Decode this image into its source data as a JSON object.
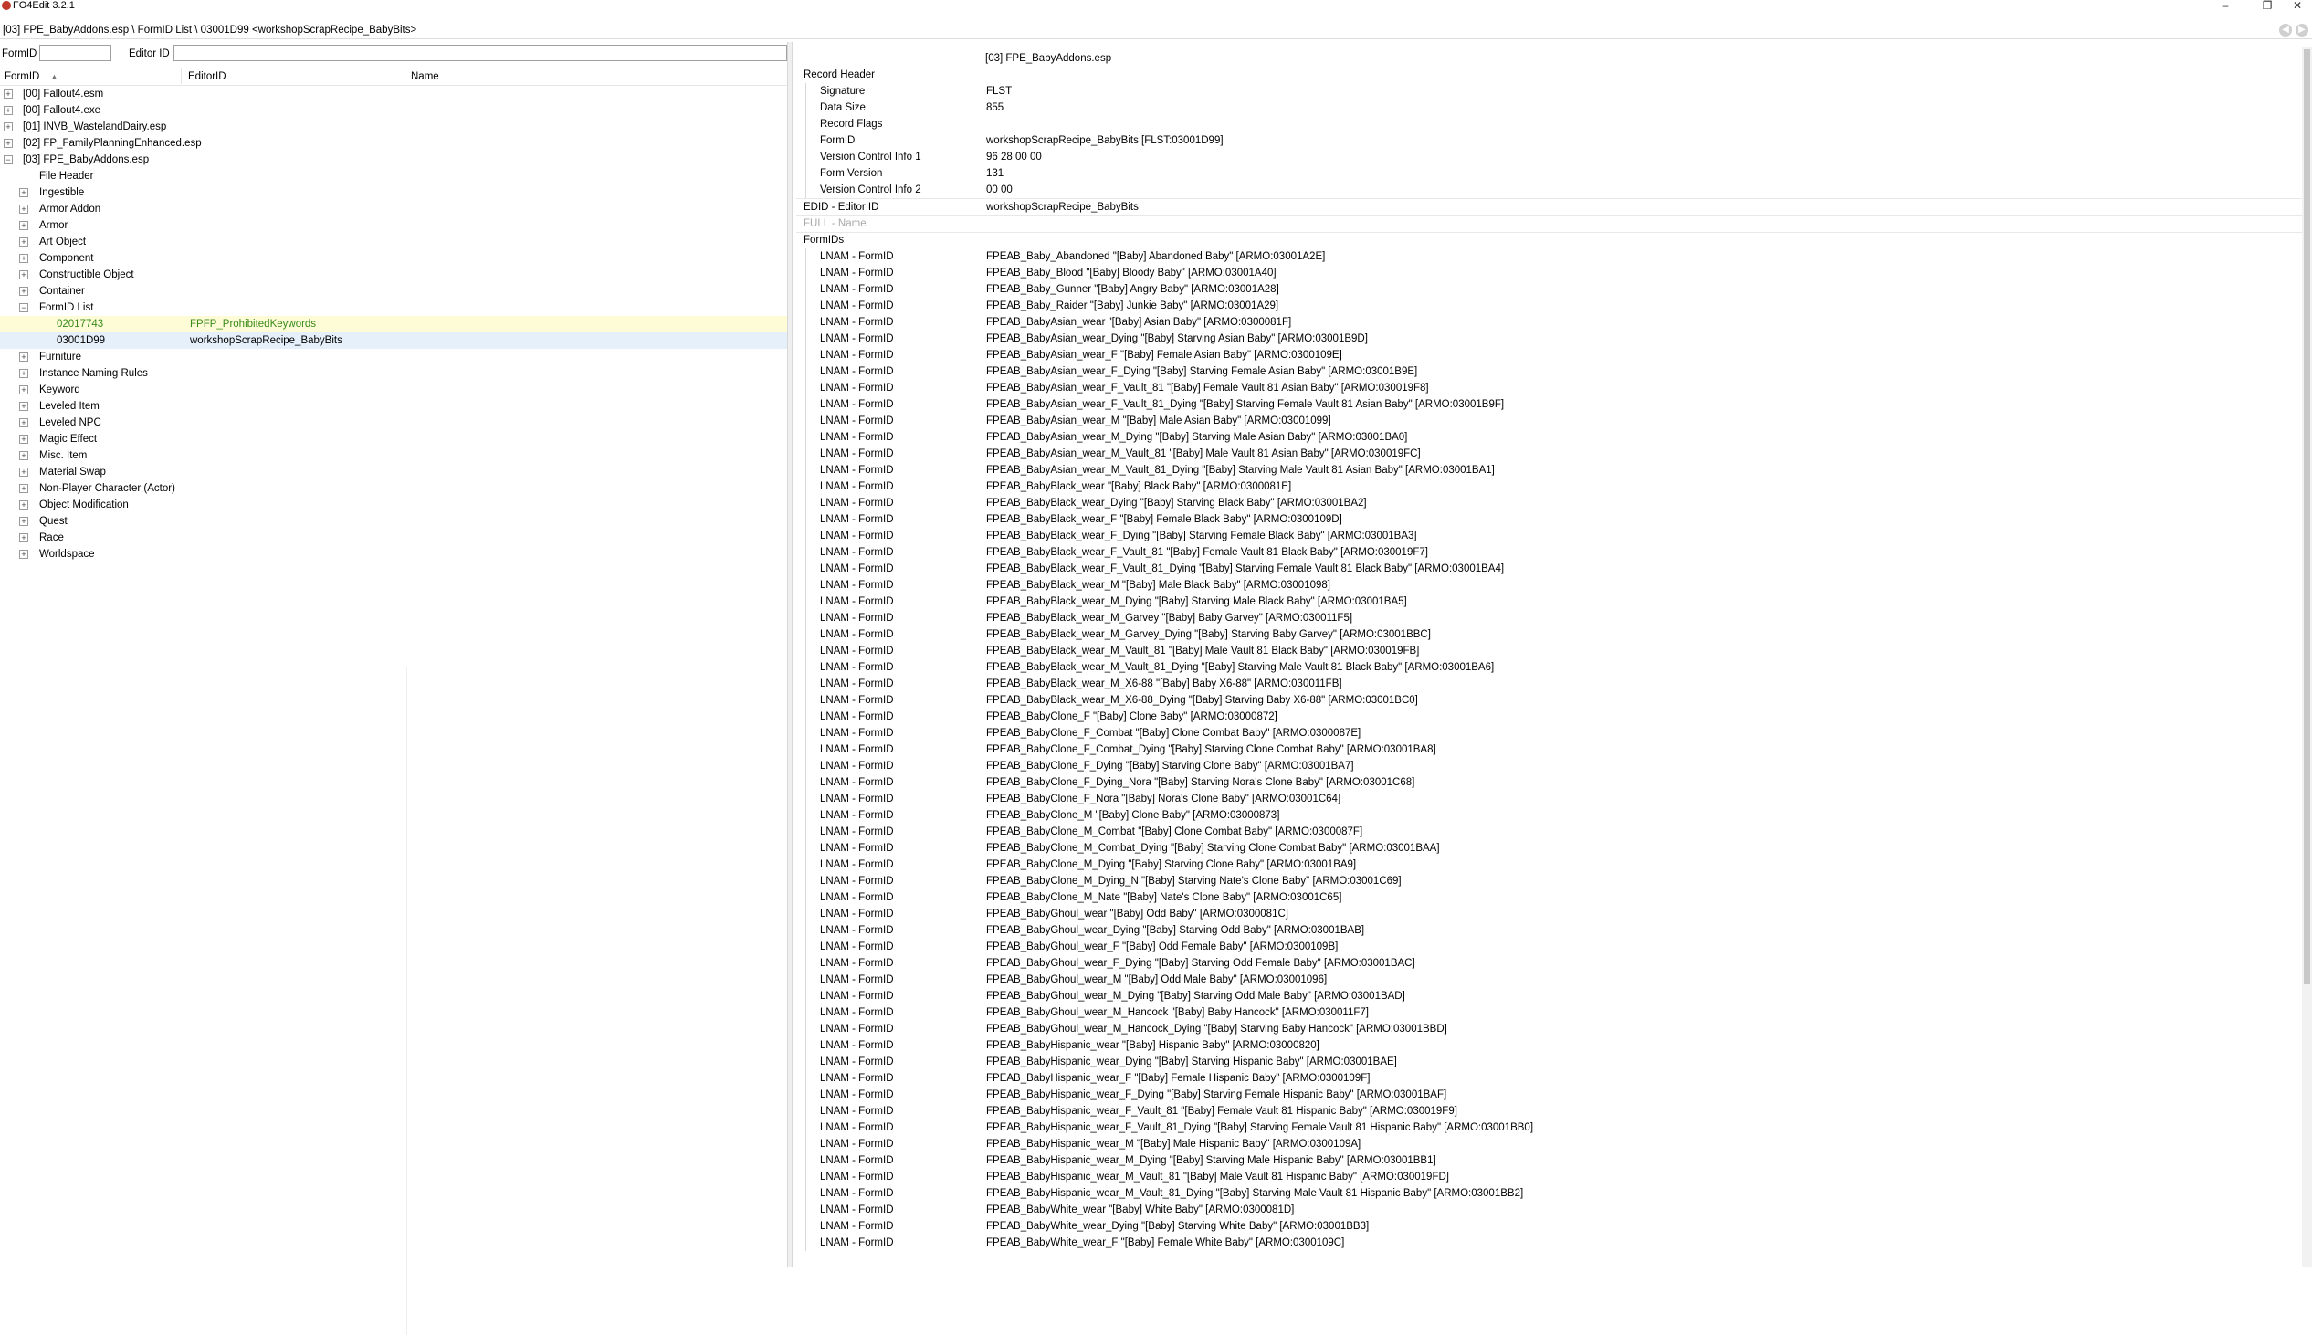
{
  "window": {
    "title": "FO4Edit 3.2.1",
    "minimize": "–",
    "maximize": "❐",
    "close": "✕"
  },
  "path": {
    "text": "[03] FPE_BabyAddons.esp \\ FormID List \\ 03001D99 <workshopScrapRecipe_BabyBits>",
    "back_icon": "back-icon",
    "forward_icon": "forward-icon"
  },
  "filter": {
    "formid_label": "FormID",
    "formid_value": "",
    "editorid_label": "Editor ID",
    "editorid_value": ""
  },
  "left_columns": {
    "formid": "FormID",
    "editorid": "EditorID",
    "name": "Name",
    "sort_icon": "sort-ascending-icon"
  },
  "tree": {
    "files": [
      {
        "label": "[00] Fallout4.esm",
        "expanded": false
      },
      {
        "label": "[00] Fallout4.exe",
        "expanded": false
      },
      {
        "label": "[01] INVB_WastelandDairy.esp",
        "expanded": false
      },
      {
        "label": "[02] FP_FamilyPlanningEnhanced.esp",
        "expanded": false
      },
      {
        "label": "[03] FPE_BabyAddons.esp",
        "expanded": true
      }
    ],
    "file_header": "File Header",
    "groups_a": [
      "Ingestible",
      "Armor Addon",
      "Armor",
      "Art Object",
      "Component",
      "Constructible Object",
      "Container"
    ],
    "formid_list": "FormID List",
    "formid_records": [
      {
        "formid": "02017743",
        "editorid": "FPFP_ProhibitedKeywords"
      },
      {
        "formid": "03001D99",
        "editorid": "workshopScrapRecipe_BabyBits"
      }
    ],
    "groups_b": [
      "Furniture",
      "Instance Naming Rules",
      "Keyword",
      "Leveled Item",
      "Leveled NPC",
      "Magic Effect",
      "Misc. Item",
      "Material Swap",
      "Non-Player Character (Actor)",
      "Object Modification",
      "Quest",
      "Race",
      "Worldspace"
    ]
  },
  "record": {
    "file_column": "[03] FPE_BabyAddons.esp",
    "header_label": "Record Header",
    "header_fields": [
      {
        "key": "Signature",
        "value": "FLST"
      },
      {
        "key": "Data Size",
        "value": "855"
      },
      {
        "key": "Record Flags",
        "value": ""
      },
      {
        "key": "FormID",
        "value": "workshopScrapRecipe_BabyBits [FLST:03001D99]"
      },
      {
        "key": "Version Control Info 1",
        "value": "96 28 00 00"
      },
      {
        "key": "Form Version",
        "value": "131"
      },
      {
        "key": "Version Control Info 2",
        "value": "00 00"
      }
    ],
    "edid_key": "EDID - Editor ID",
    "edid_value": "workshopScrapRecipe_BabyBits",
    "full_key": "FULL - Name",
    "formids_label": "FormIDs",
    "lnam_key": "LNAM - FormID",
    "lnam_values": [
      "FPEAB_Baby_Abandoned \"[Baby] Abandoned Baby\" [ARMO:03001A2E]",
      "FPEAB_Baby_Blood \"[Baby] Bloody Baby\" [ARMO:03001A40]",
      "FPEAB_Baby_Gunner \"[Baby] Angry Baby\" [ARMO:03001A28]",
      "FPEAB_Baby_Raider \"[Baby] Junkie Baby\" [ARMO:03001A29]",
      "FPEAB_BabyAsian_wear \"[Baby] Asian Baby\" [ARMO:0300081F]",
      "FPEAB_BabyAsian_wear_Dying \"[Baby] Starving Asian Baby\" [ARMO:03001B9D]",
      "FPEAB_BabyAsian_wear_F \"[Baby] Female Asian Baby\" [ARMO:0300109E]",
      "FPEAB_BabyAsian_wear_F_Dying \"[Baby] Starving Female Asian Baby\" [ARMO:03001B9E]",
      "FPEAB_BabyAsian_wear_F_Vault_81 \"[Baby] Female Vault 81 Asian Baby\" [ARMO:030019F8]",
      "FPEAB_BabyAsian_wear_F_Vault_81_Dying \"[Baby] Starving Female Vault 81 Asian Baby\" [ARMO:03001B9F]",
      "FPEAB_BabyAsian_wear_M \"[Baby] Male Asian Baby\" [ARMO:03001099]",
      "FPEAB_BabyAsian_wear_M_Dying \"[Baby] Starving Male Asian Baby\" [ARMO:03001BA0]",
      "FPEAB_BabyAsian_wear_M_Vault_81 \"[Baby] Male Vault 81 Asian Baby\" [ARMO:030019FC]",
      "FPEAB_BabyAsian_wear_M_Vault_81_Dying \"[Baby] Starving Male Vault 81 Asian Baby\" [ARMO:03001BA1]",
      "FPEAB_BabyBlack_wear \"[Baby] Black Baby\" [ARMO:0300081E]",
      "FPEAB_BabyBlack_wear_Dying \"[Baby] Starving Black Baby\" [ARMO:03001BA2]",
      "FPEAB_BabyBlack_wear_F \"[Baby] Female Black Baby\" [ARMO:0300109D]",
      "FPEAB_BabyBlack_wear_F_Dying \"[Baby] Starving Female Black Baby\" [ARMO:03001BA3]",
      "FPEAB_BabyBlack_wear_F_Vault_81 \"[Baby] Female Vault 81 Black Baby\" [ARMO:030019F7]",
      "FPEAB_BabyBlack_wear_F_Vault_81_Dying \"[Baby] Starving Female Vault 81 Black Baby\" [ARMO:03001BA4]",
      "FPEAB_BabyBlack_wear_M \"[Baby] Male Black Baby\" [ARMO:03001098]",
      "FPEAB_BabyBlack_wear_M_Dying \"[Baby] Starving Male Black Baby\" [ARMO:03001BA5]",
      "FPEAB_BabyBlack_wear_M_Garvey \"[Baby] Baby Garvey\" [ARMO:030011F5]",
      "FPEAB_BabyBlack_wear_M_Garvey_Dying \"[Baby] Starving Baby Garvey\" [ARMO:03001BBC]",
      "FPEAB_BabyBlack_wear_M_Vault_81 \"[Baby] Male Vault 81 Black Baby\" [ARMO:030019FB]",
      "FPEAB_BabyBlack_wear_M_Vault_81_Dying \"[Baby] Starving Male Vault 81 Black Baby\" [ARMO:03001BA6]",
      "FPEAB_BabyBlack_wear_M_X6-88 \"[Baby] Baby X6-88\" [ARMO:030011FB]",
      "FPEAB_BabyBlack_wear_M_X6-88_Dying \"[Baby] Starving Baby X6-88\" [ARMO:03001BC0]",
      "FPEAB_BabyClone_F \"[Baby] Clone Baby\" [ARMO:03000872]",
      "FPEAB_BabyClone_F_Combat \"[Baby] Clone Combat Baby\" [ARMO:0300087E]",
      "FPEAB_BabyClone_F_Combat_Dying \"[Baby] Starving Clone Combat Baby\" [ARMO:03001BA8]",
      "FPEAB_BabyClone_F_Dying \"[Baby] Starving Clone Baby\" [ARMO:03001BA7]",
      "FPEAB_BabyClone_F_Dying_Nora \"[Baby] Starving Nora's Clone Baby\" [ARMO:03001C68]",
      "FPEAB_BabyClone_F_Nora \"[Baby] Nora's Clone Baby\" [ARMO:03001C64]",
      "FPEAB_BabyClone_M \"[Baby] Clone Baby\" [ARMO:03000873]",
      "FPEAB_BabyClone_M_Combat \"[Baby] Clone Combat Baby\" [ARMO:0300087F]",
      "FPEAB_BabyClone_M_Combat_Dying \"[Baby] Starving Clone Combat Baby\" [ARMO:03001BAA]",
      "FPEAB_BabyClone_M_Dying \"[Baby] Starving Clone Baby\" [ARMO:03001BA9]",
      "FPEAB_BabyClone_M_Dying_N \"[Baby] Starving Nate's Clone Baby\" [ARMO:03001C69]",
      "FPEAB_BabyClone_M_Nate \"[Baby] Nate's Clone Baby\" [ARMO:03001C65]",
      "FPEAB_BabyGhoul_wear \"[Baby] Odd Baby\" [ARMO:0300081C]",
      "FPEAB_BabyGhoul_wear_Dying \"[Baby] Starving Odd Baby\" [ARMO:03001BAB]",
      "FPEAB_BabyGhoul_wear_F \"[Baby] Odd Female Baby\" [ARMO:0300109B]",
      "FPEAB_BabyGhoul_wear_F_Dying \"[Baby] Starving Odd Female Baby\" [ARMO:03001BAC]",
      "FPEAB_BabyGhoul_wear_M \"[Baby] Odd Male Baby\" [ARMO:03001096]",
      "FPEAB_BabyGhoul_wear_M_Dying \"[Baby] Starving Odd Male Baby\" [ARMO:03001BAD]",
      "FPEAB_BabyGhoul_wear_M_Hancock \"[Baby] Baby Hancock\" [ARMO:030011F7]",
      "FPEAB_BabyGhoul_wear_M_Hancock_Dying \"[Baby] Starving Baby Hancock\" [ARMO:03001BBD]",
      "FPEAB_BabyHispanic_wear \"[Baby] Hispanic Baby\" [ARMO:03000820]",
      "FPEAB_BabyHispanic_wear_Dying \"[Baby] Starving Hispanic Baby\" [ARMO:03001BAE]",
      "FPEAB_BabyHispanic_wear_F \"[Baby] Female Hispanic Baby\" [ARMO:0300109F]",
      "FPEAB_BabyHispanic_wear_F_Dying \"[Baby] Starving Female Hispanic Baby\" [ARMO:03001BAF]",
      "FPEAB_BabyHispanic_wear_F_Vault_81 \"[Baby] Female Vault 81 Hispanic Baby\" [ARMO:030019F9]",
      "FPEAB_BabyHispanic_wear_F_Vault_81_Dying \"[Baby] Starving Female Vault 81 Hispanic Baby\" [ARMO:03001BB0]",
      "FPEAB_BabyHispanic_wear_M \"[Baby] Male Hispanic Baby\" [ARMO:0300109A]",
      "FPEAB_BabyHispanic_wear_M_Dying \"[Baby] Starving Male Hispanic Baby\" [ARMO:03001BB1]",
      "FPEAB_BabyHispanic_wear_M_Vault_81 \"[Baby] Male Vault 81 Hispanic Baby\" [ARMO:030019FD]",
      "FPEAB_BabyHispanic_wear_M_Vault_81_Dying \"[Baby] Starving Male Vault 81 Hispanic Baby\" [ARMO:03001BB2]",
      "FPEAB_BabyWhite_wear \"[Baby] White Baby\" [ARMO:0300081D]",
      "FPEAB_BabyWhite_wear_Dying \"[Baby] Starving White Baby\" [ARMO:03001BB3]",
      "FPEAB_BabyWhite_wear_F \"[Baby] Female White Baby\" [ARMO:0300109C]"
    ]
  },
  "colors": {
    "highlight_row": "#fdfcd6",
    "selected_row": "#e6f0fa",
    "green_text": "#3a8a1a"
  }
}
